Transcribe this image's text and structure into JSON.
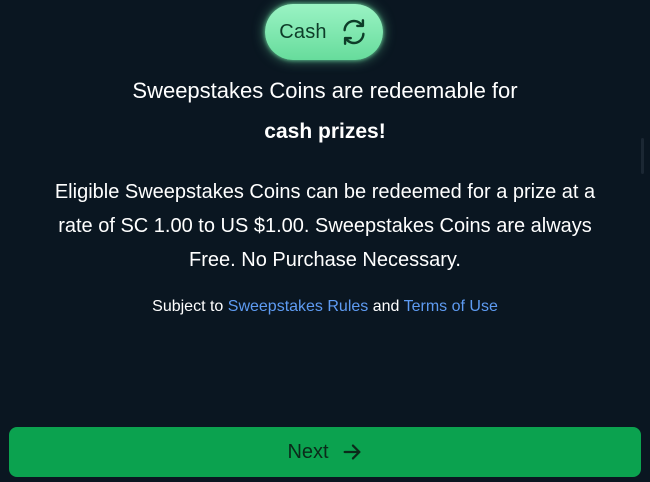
{
  "currency_toggle": {
    "label": "Cash",
    "icon": "refresh-icon"
  },
  "headline": {
    "line1": "Sweepstakes Coins are redeemable for",
    "line2": "cash prizes!"
  },
  "description": {
    "line1": "Eligible Sweepstakes Coins can be redeemed for a prize at a",
    "line2": "rate of SC 1.00 to US $1.00. Sweepstakes Coins are always",
    "line3": "Free. No Purchase Necessary."
  },
  "legal": {
    "prefix": "Subject to",
    "rules_link": "Sweepstakes Rules",
    "conjunction": "and",
    "terms_link": "Terms of Use"
  },
  "next_button": {
    "label": "Next",
    "icon": "arrow-right-icon"
  },
  "colors": {
    "background": "#0a1621",
    "pill": "#7fe8b0",
    "link": "#5e9bf2",
    "button": "#0ba24f"
  }
}
